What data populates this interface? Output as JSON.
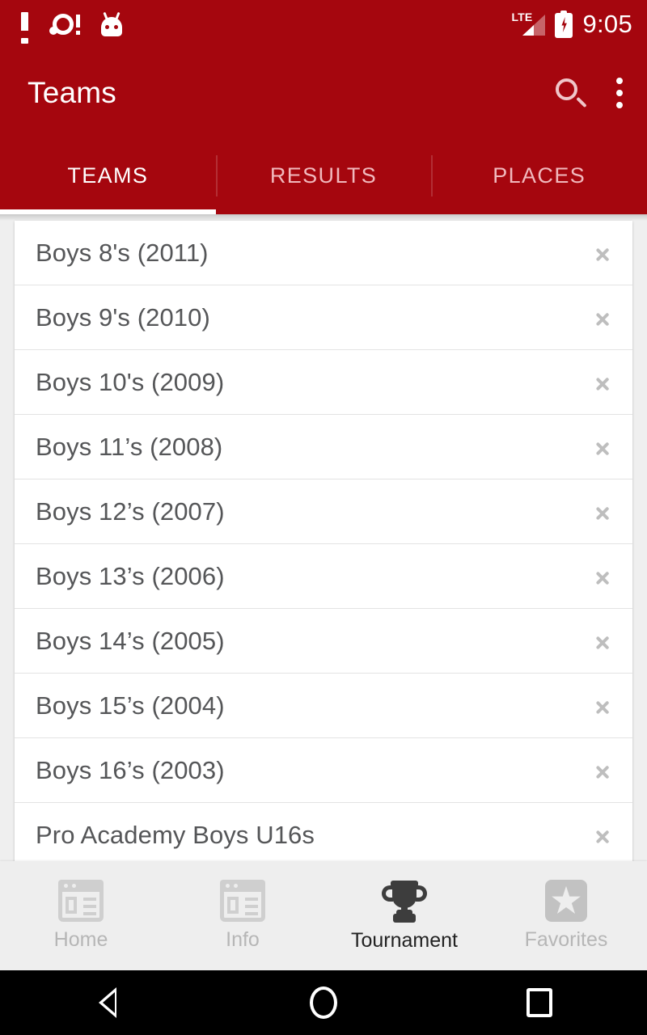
{
  "status_bar": {
    "time": "9:05",
    "network_label": "LTE",
    "icons": [
      "exclamation-icon",
      "notification-icon",
      "android-head-icon",
      "lte-signal-icon",
      "battery-charging-icon"
    ]
  },
  "app_bar": {
    "title": "Teams",
    "search_icon": "search-icon",
    "overflow_icon": "more-vert-icon"
  },
  "tabs": {
    "active_index": 0,
    "items": [
      {
        "label": "TEAMS"
      },
      {
        "label": "RESULTS"
      },
      {
        "label": "PLACES"
      }
    ]
  },
  "team_list": {
    "rows": [
      {
        "label": "Boys 8's (2011)"
      },
      {
        "label": "Boys 9's (2010)"
      },
      {
        "label": "Boys 10's (2009)"
      },
      {
        "label": "Boys 11’s (2008)"
      },
      {
        "label": "Boys 12’s (2007)"
      },
      {
        "label": "Boys 13’s (2006)"
      },
      {
        "label": "Boys 14’s (2005)"
      },
      {
        "label": "Boys 15’s (2004)"
      },
      {
        "label": "Boys 16’s (2003)"
      },
      {
        "label": "Pro Academy Boys U16s"
      }
    ]
  },
  "bottom_nav": {
    "active_index": 2,
    "items": [
      {
        "label": "Home",
        "icon": "article-icon"
      },
      {
        "label": "Info",
        "icon": "article-icon"
      },
      {
        "label": "Tournament",
        "icon": "trophy-icon"
      },
      {
        "label": "Favorites",
        "icon": "star-icon"
      }
    ]
  },
  "android_nav": {
    "back": "back-icon",
    "home": "home-icon",
    "recents": "recents-icon"
  },
  "colors": {
    "primary": "#a5060e",
    "tab_inactive": "#f1b9bd",
    "page_background": "#efefef",
    "row_text": "#555658",
    "nav_active": "#222222",
    "nav_inactive": "#b6b6b6"
  }
}
